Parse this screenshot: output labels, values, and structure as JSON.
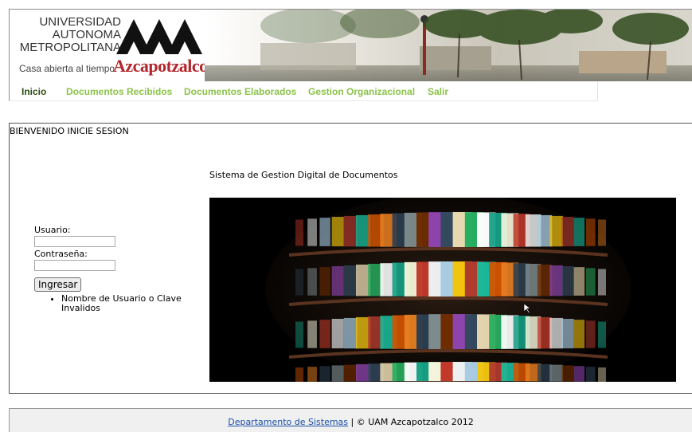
{
  "header": {
    "logo_lines": [
      "UNIVERSIDAD",
      "AUTONOMA",
      "METROPOLITANA"
    ],
    "tagline": "Casa abierta al tiempo",
    "campus": "Azcapotzalco"
  },
  "nav": {
    "items": [
      {
        "label": "Inicio",
        "active": true
      },
      {
        "label": "Documentos Recibidos"
      },
      {
        "label": "Documentos Elaborados"
      },
      {
        "label": "Gestion Organizacional"
      },
      {
        "label": "Salir"
      }
    ]
  },
  "content": {
    "welcome": "BIENVENIDO INICIE SESION",
    "system_title": "Sistema de Gestion Digital de Documentos",
    "login": {
      "user_label": "Usuario:",
      "user_value": "",
      "password_label": "Contraseña:",
      "password_value": "",
      "button": "Ingresar",
      "errors": [
        "Nombre de Usuario o Clave Invalidos"
      ]
    }
  },
  "footer": {
    "link": "Departamento de Sistemas",
    "text": " | © UAM Azcapotzalco 2012"
  },
  "colors": {
    "nav_active": "#2d4d12",
    "nav_link": "#8bc34a",
    "brand_red": "#b3252a",
    "footer_link": "#1a4fa8"
  }
}
